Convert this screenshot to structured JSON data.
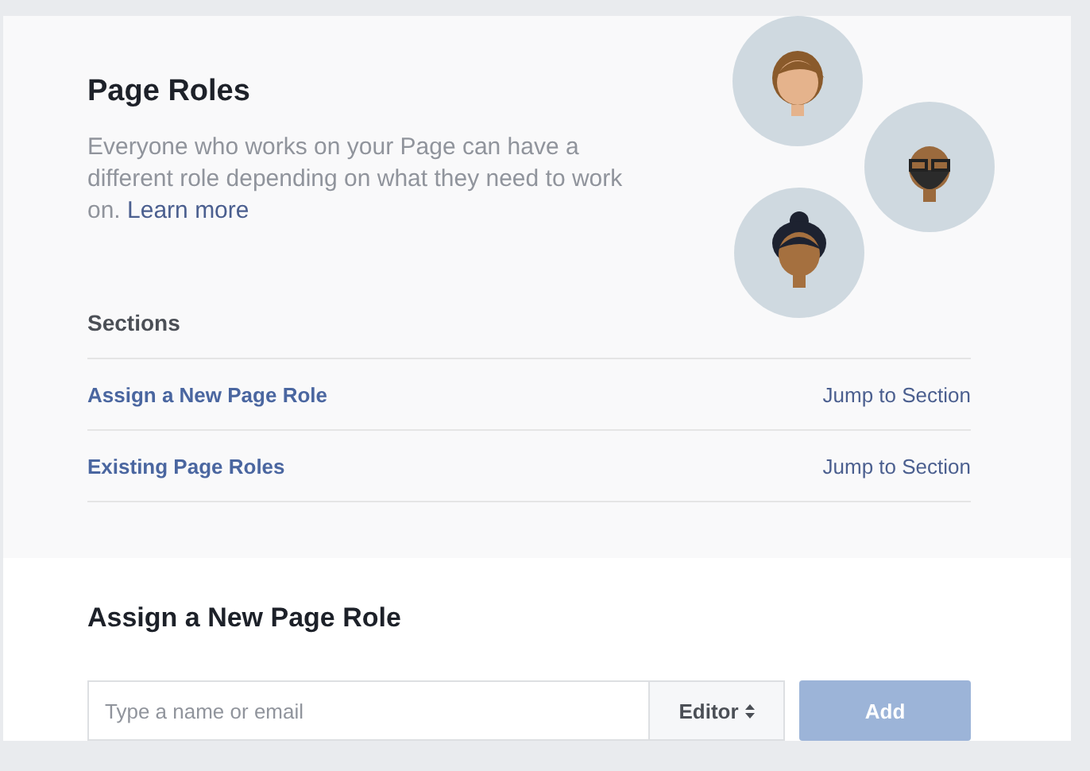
{
  "header": {
    "title": "Page Roles",
    "description": "Everyone who works on your Page can have a different role depending on what they need to work on.",
    "link": "Learn more"
  },
  "sections": {
    "title": "Sections",
    "items": [
      {
        "label": "Assign a New Page Role",
        "action": "Jump to Section"
      },
      {
        "label": "Existing Page Roles",
        "action": "Jump to Section"
      }
    ]
  },
  "assign": {
    "title": "Assign a New Page Role",
    "input": {
      "placeholder": "Type a name or email"
    },
    "role": "Editor",
    "add_button": {
      "label": "Add",
      "disabled": true
    }
  }
}
